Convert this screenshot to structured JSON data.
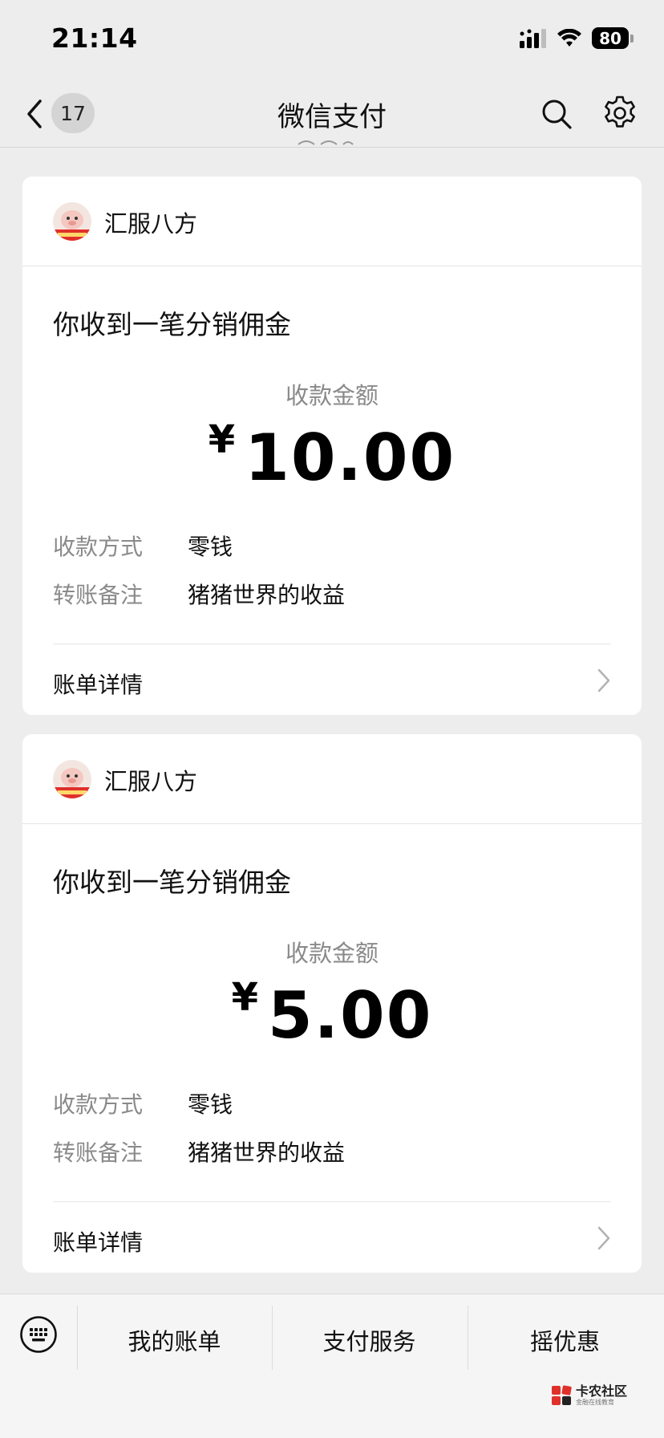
{
  "status_bar": {
    "time": "21:14",
    "battery": "80",
    "icons": [
      "signal-icon",
      "wifi-icon",
      "battery-icon"
    ]
  },
  "nav": {
    "title": "微信支付",
    "unread_badge": "17",
    "icons": [
      "back-icon",
      "search-icon",
      "gear-icon"
    ]
  },
  "cards": [
    {
      "sender": "汇服八方",
      "title": "你收到一笔分销佣金",
      "amount_label": "收款金额",
      "currency": "¥",
      "amount": "10.00",
      "method_key": "收款方式",
      "method_value": "零钱",
      "note_key": "转账备注",
      "note_value": "猪猪世界的收益",
      "detail_label": "账单详情"
    },
    {
      "sender": "汇服八方",
      "title": "你收到一笔分销佣金",
      "amount_label": "收款金额",
      "currency": "¥",
      "amount": "5.00",
      "method_key": "收款方式",
      "method_value": "零钱",
      "note_key": "转账备注",
      "note_value": "猪猪世界的收益",
      "detail_label": "账单详情"
    }
  ],
  "bottom_bar": {
    "tabs": [
      "我的账单",
      "支付服务",
      "摇优惠"
    ],
    "watermark_main": "卡农社区",
    "watermark_sub": "金融在线教育"
  },
  "colors": {
    "background": "#ededed",
    "card": "#ffffff",
    "muted_text": "#8a8a8a",
    "avatar_badge": "#e0302a"
  }
}
